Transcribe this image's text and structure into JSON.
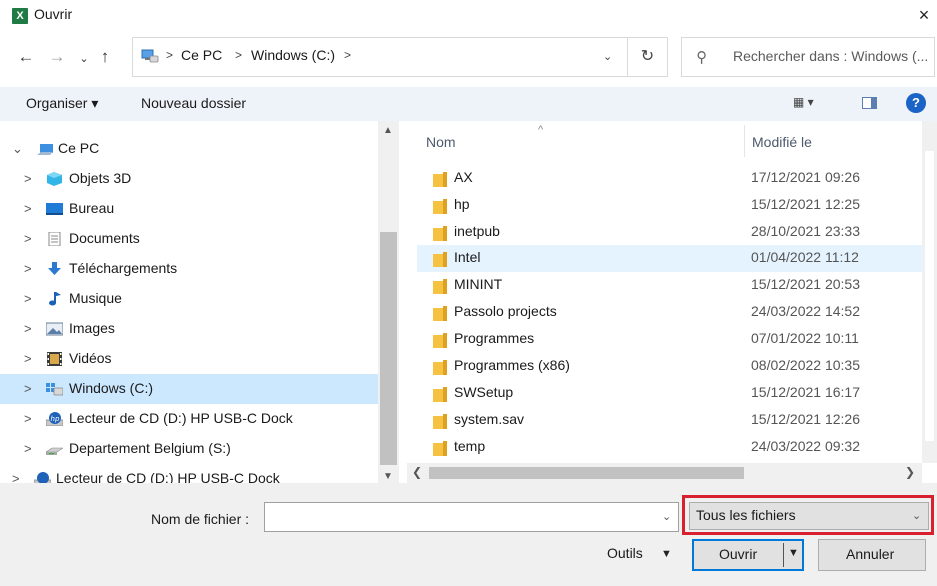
{
  "window": {
    "title": "Ouvrir",
    "app_icon_letter": "X",
    "close_glyph": "×"
  },
  "navigation": {
    "back_glyph": "←",
    "forward_glyph": "→",
    "recent_glyph": "⌄",
    "up_glyph": "↑",
    "breadcrumbs": [
      "Ce PC",
      "Windows (C:)"
    ],
    "breadcrumb_separator": ">",
    "address_dropdown_glyph": "⌄",
    "refresh_glyph": "↻"
  },
  "search": {
    "placeholder": "Rechercher dans : Windows (...",
    "icon": "search-icon"
  },
  "toolbar": {
    "organize_label": "Organiser ▾",
    "new_folder_label": "Nouveau dossier",
    "view_label": "▦ ▾",
    "help_label": "?"
  },
  "sidebar": {
    "items": [
      {
        "label": "Ce PC",
        "chevron": "⌄",
        "icon": "pc-icon"
      },
      {
        "label": "Objets 3D",
        "chevron": ">",
        "icon": "objects3d-icon"
      },
      {
        "label": "Bureau",
        "chevron": ">",
        "icon": "desktop-icon"
      },
      {
        "label": "Documents",
        "chevron": ">",
        "icon": "documents-icon"
      },
      {
        "label": "Téléchargements",
        "chevron": ">",
        "icon": "downloads-icon"
      },
      {
        "label": "Musique",
        "chevron": ">",
        "icon": "music-icon"
      },
      {
        "label": "Images",
        "chevron": ">",
        "icon": "images-icon"
      },
      {
        "label": "Vidéos",
        "chevron": ">",
        "icon": "videos-icon"
      },
      {
        "label": "Windows (C:)",
        "chevron": ">",
        "icon": "drive-icon",
        "selected": true
      },
      {
        "label": "Lecteur de CD (D:) HP USB-C Dock",
        "chevron": ">",
        "icon": "cd-drive-icon"
      },
      {
        "label": "Departement Belgium (S:)",
        "chevron": ">",
        "icon": "network-drive-icon"
      },
      {
        "label": "Lecteur de CD (D:) HP USB-C Dock",
        "chevron": ">",
        "icon": "cd-drive-icon"
      }
    ]
  },
  "files": {
    "columns": [
      "Nom",
      "Modifié le"
    ],
    "sort_glyph": "^",
    "rows": [
      {
        "name": "AX",
        "modified": "17/12/2021 09:26"
      },
      {
        "name": "hp",
        "modified": "15/12/2021 12:25"
      },
      {
        "name": "inetpub",
        "modified": "28/10/2021 23:33"
      },
      {
        "name": "Intel",
        "modified": "01/04/2022 11:12",
        "hover": true
      },
      {
        "name": "MININT",
        "modified": "15/12/2021 20:53"
      },
      {
        "name": "Passolo projects",
        "modified": "24/03/2022 14:52"
      },
      {
        "name": "Programmes",
        "modified": "07/01/2022 10:11"
      },
      {
        "name": "Programmes (x86)",
        "modified": "08/02/2022 10:35"
      },
      {
        "name": "SWSetup",
        "modified": "15/12/2021 16:17"
      },
      {
        "name": "system.sav",
        "modified": "15/12/2021 12:26"
      },
      {
        "name": "temp",
        "modified": "24/03/2022 09:32"
      }
    ]
  },
  "footer": {
    "filename_label": "Nom de fichier :",
    "filename_value": "",
    "dropdown_glyph": "⌄",
    "filter_value": "Tous les fichiers",
    "tools_label": "Outils",
    "tools_dropdown_glyph": "▼",
    "open_label": "Ouvrir",
    "open_dropdown_glyph": "▼",
    "cancel_label": "Annuler"
  },
  "colors": {
    "accent": "#0078d7",
    "selection": "#cce8ff",
    "hover": "#e5f3ff",
    "highlight_box": "#d9202f",
    "folder": "#f5c242",
    "excel_green": "#1f7a43"
  }
}
